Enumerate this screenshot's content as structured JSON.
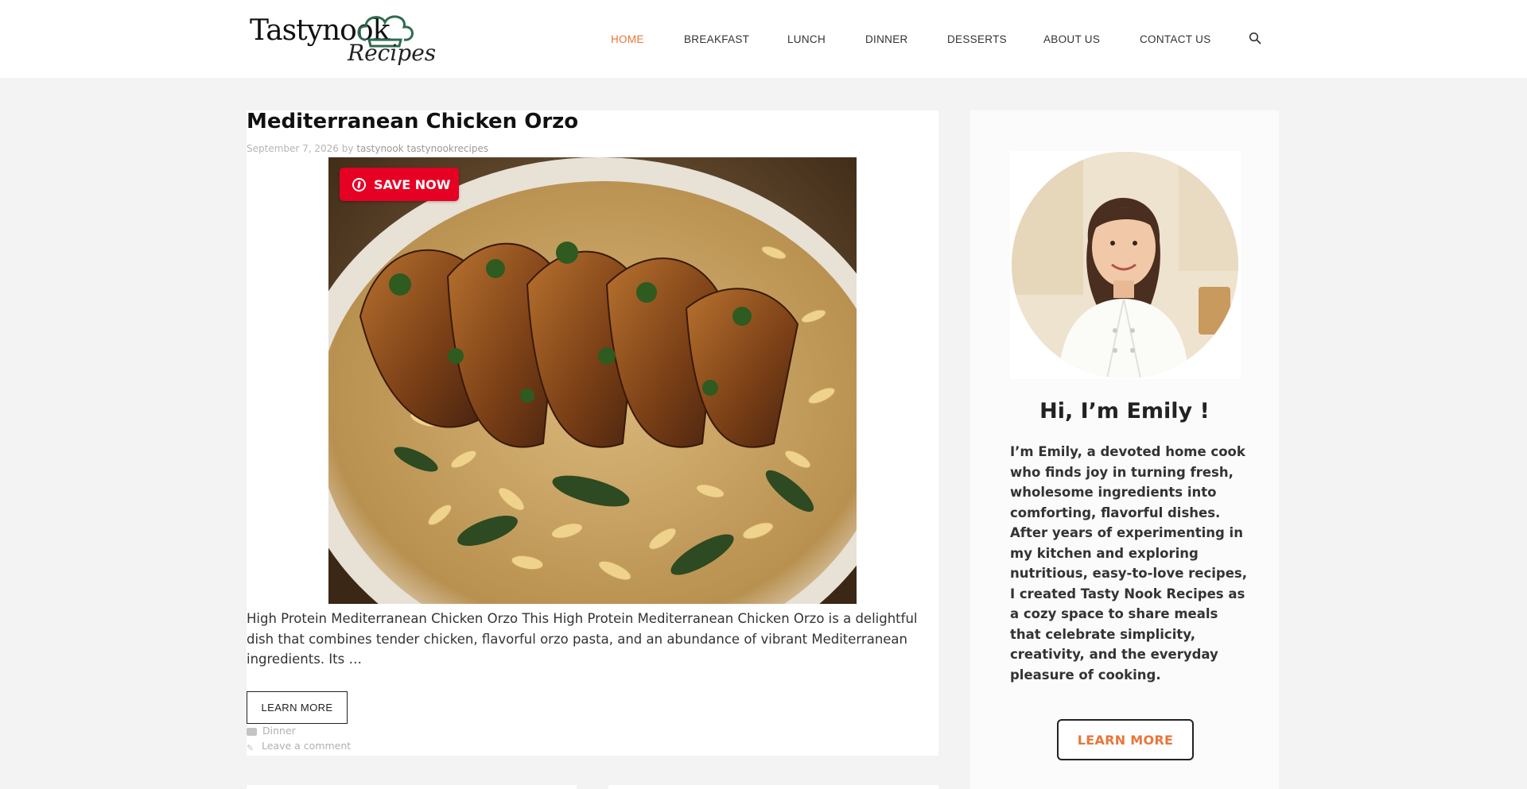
{
  "brand": {
    "logo_line1": "Tastynook",
    "logo_line2": "Recipes"
  },
  "nav": {
    "items": [
      "HOME",
      "BREAKFAST",
      "LUNCH",
      "DINNER",
      "DESSERTS",
      "ABOUT US",
      "CONTACT US"
    ],
    "active": "HOME",
    "search_icon": "search-icon"
  },
  "post": {
    "title": "Mediterranean Chicken Orzo",
    "date": "September 7, 2026",
    "by": "by",
    "author": "tastynook tastynookrecipes",
    "save_label": "SAVE NOW",
    "excerpt": "High Protein Mediterranean Chicken Orzo This High Protein Mediterranean Chicken Orzo is a delightful dish that combines tender chicken, flavorful orzo pasta, and an abundance of vibrant Mediterranean ingredients. Its …",
    "learn_more": "LEARN MORE",
    "category": "Dinner",
    "comment_link": "Leave a comment"
  },
  "sidebar": {
    "greeting": "Hi, I’m Emily !",
    "bio": "I’m Emily, a devoted home cook who finds joy in turning fresh, wholesome ingredients into comforting, flavorful dishes. After years of experimenting in my kitchen and exploring nutritious, easy-to-love recipes, I created Tasty Nook Recipes as a cozy space to share meals that celebrate simplicity, creativity, and the everyday pleasure of cooking.",
    "button": "LEARN MORE"
  },
  "colors": {
    "accent": "#e8763a",
    "pinterest": "#e60023",
    "page_bg": "#f4f3f3"
  }
}
